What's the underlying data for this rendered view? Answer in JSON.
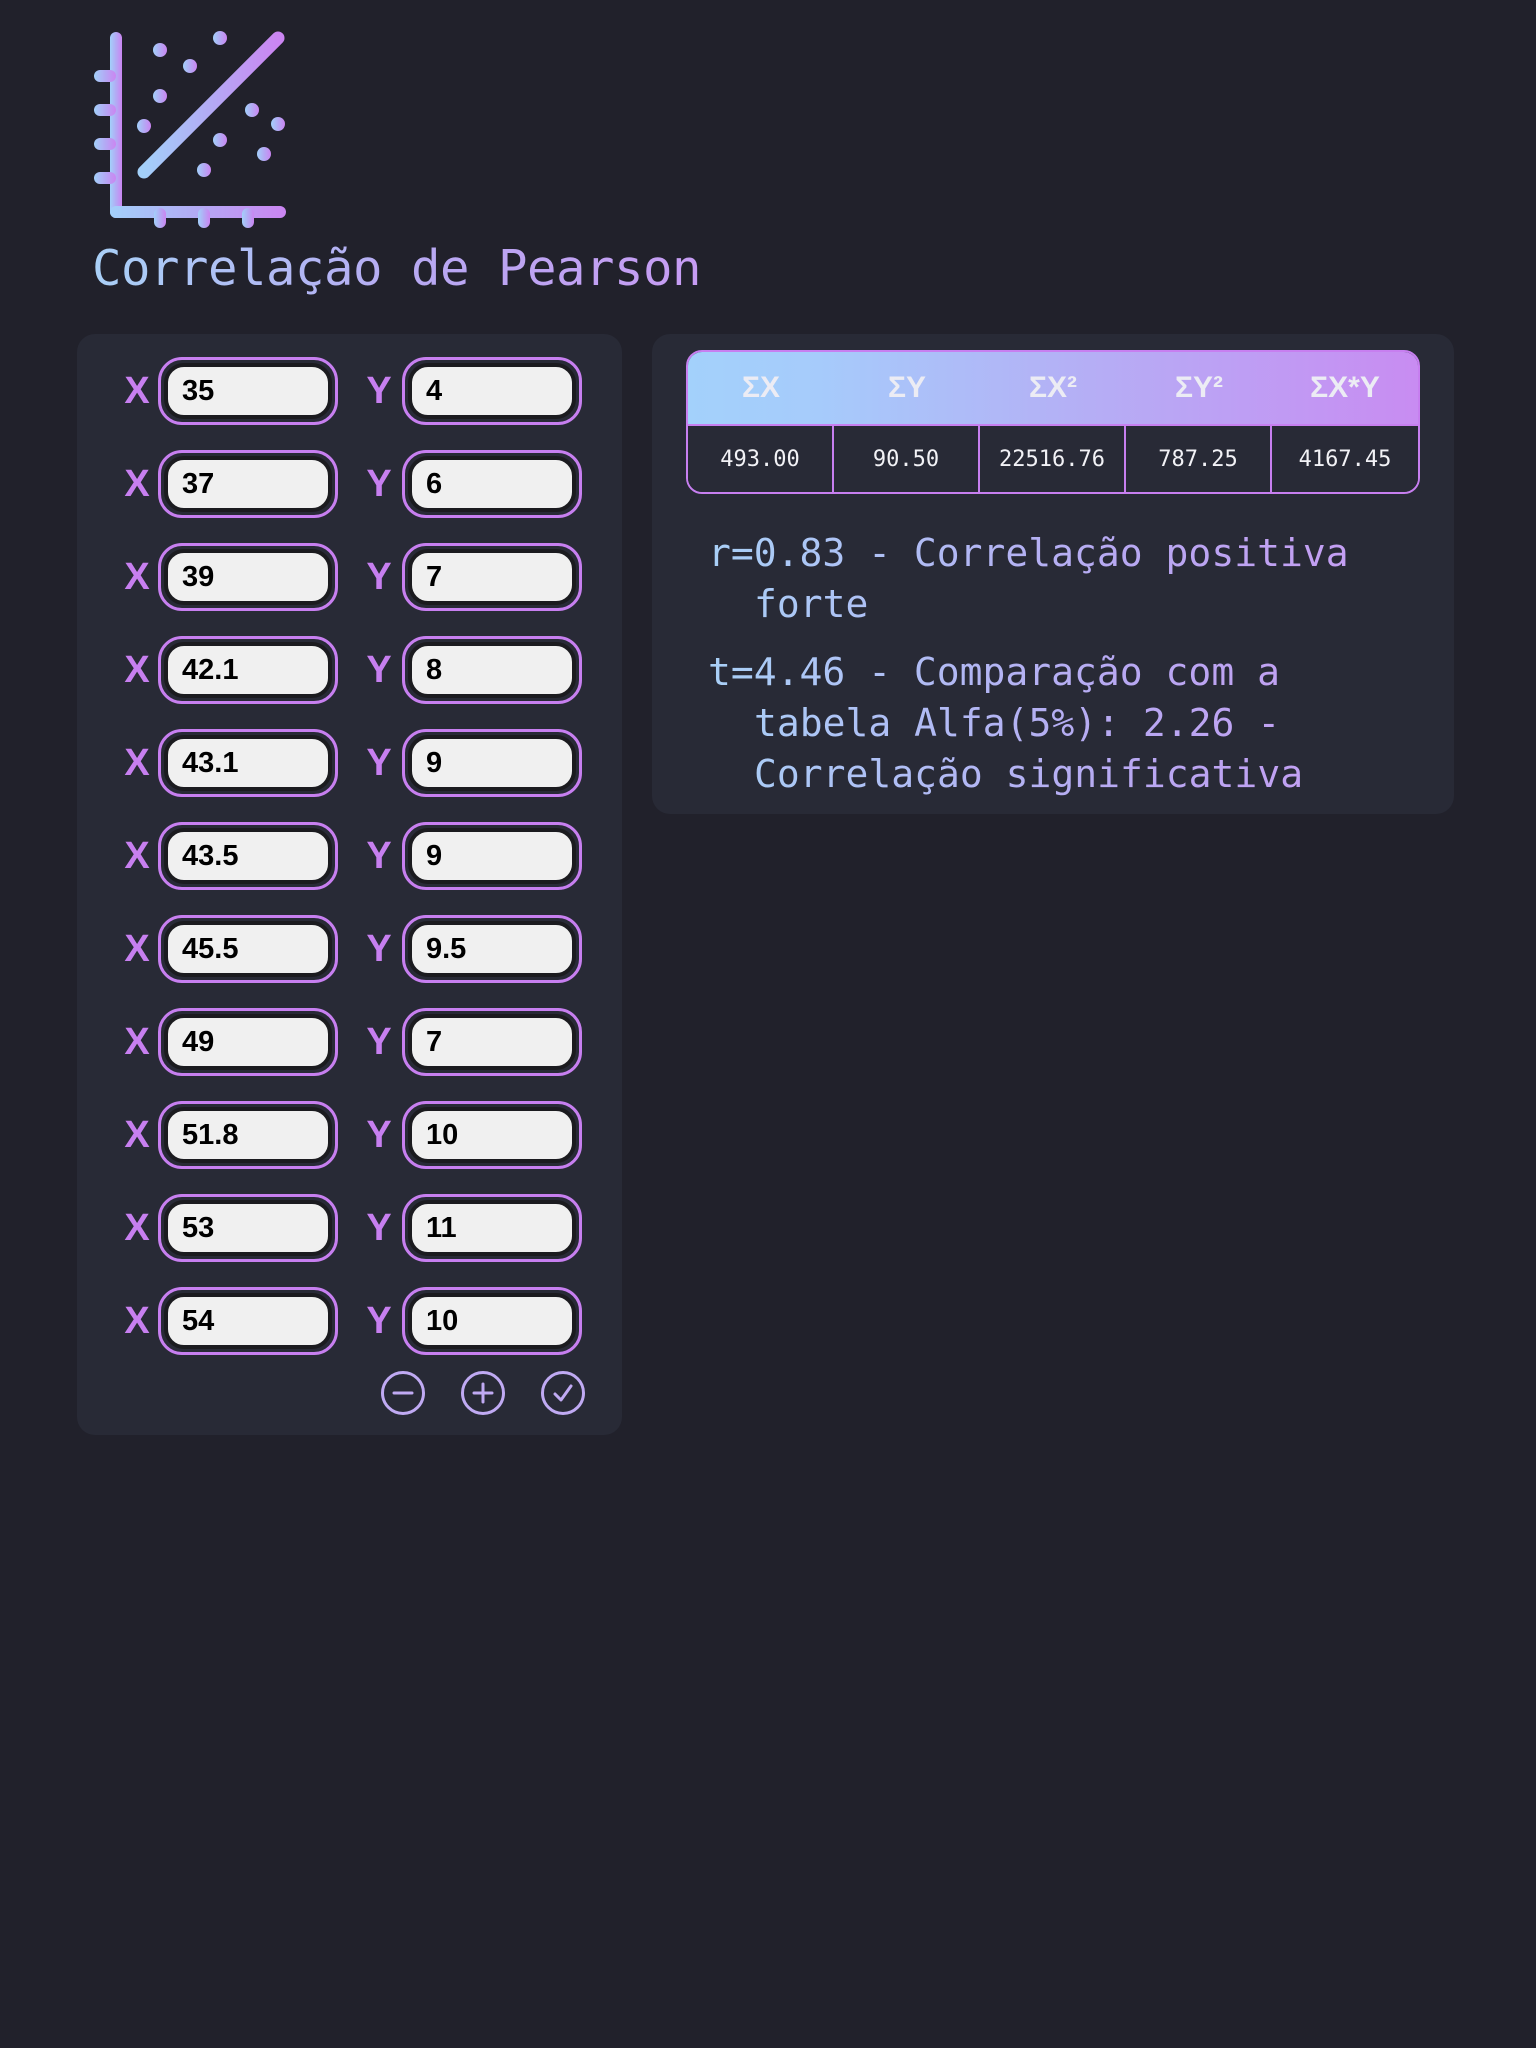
{
  "app": {
    "title": "Correlação de Pearson",
    "logo_icon": "scatter-plot-icon",
    "colors": {
      "background": "#21212b",
      "panel": "#282a36",
      "accent": "#c77ff0",
      "gradient_start": "#a9d0f7",
      "gradient_end": "#c79cf3"
    }
  },
  "inputs": {
    "x_label": "X",
    "y_label": "Y",
    "rows": [
      {
        "x": "35",
        "y": "4"
      },
      {
        "x": "37",
        "y": "6"
      },
      {
        "x": "39",
        "y": "7"
      },
      {
        "x": "42.1",
        "y": "8"
      },
      {
        "x": "43.1",
        "y": "9"
      },
      {
        "x": "43.5",
        "y": "9"
      },
      {
        "x": "45.5",
        "y": "9.5"
      },
      {
        "x": "49",
        "y": "7"
      },
      {
        "x": "51.8",
        "y": "10"
      },
      {
        "x": "53",
        "y": "11"
      },
      {
        "x": "54",
        "y": "10"
      }
    ],
    "actions": [
      {
        "name": "remove-row",
        "icon": "minus-circle-icon"
      },
      {
        "name": "add-row",
        "icon": "plus-circle-icon"
      },
      {
        "name": "calculate",
        "icon": "check-circle-icon"
      }
    ]
  },
  "results": {
    "table": {
      "headers": [
        "ΣX",
        "ΣY",
        "ΣX²",
        "ΣY²",
        "ΣX*Y"
      ],
      "values": [
        "493.00",
        "90.50",
        "22516.76",
        "787.25",
        "4167.45"
      ]
    },
    "r_text": "r=0.83 - Correlação positiva forte",
    "t_text": "t=4.46 - Comparação com a tabela Alfa(5%): 2.26 - Correlação significativa"
  }
}
